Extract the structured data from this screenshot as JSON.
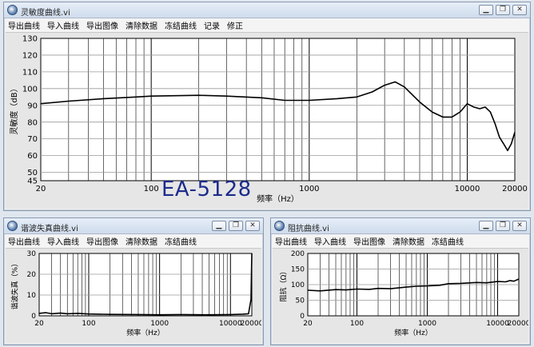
{
  "windows": [
    {
      "id": "sens",
      "title": "灵敏度曲线.vi",
      "menu": [
        "导出曲线",
        "导入曲线",
        "导出图像",
        "清除数据",
        "冻结曲线",
        "记录",
        "修正"
      ],
      "window_buttons": [
        "minimize-icon",
        "restore-icon",
        "close-icon"
      ]
    },
    {
      "id": "thd",
      "title": "谐波失真曲线.vi",
      "menu": [
        "导出曲线",
        "导入曲线",
        "导出图像",
        "清除数据",
        "冻结曲线"
      ],
      "window_buttons": [
        "minimize-icon",
        "restore-icon",
        "close-icon"
      ]
    },
    {
      "id": "imp",
      "title": "阻抗曲线.vi",
      "menu": [
        "导出曲线",
        "导入曲线",
        "导出图像",
        "清除数据",
        "冻结曲线"
      ],
      "window_buttons": [
        "minimize-icon",
        "restore-icon",
        "close-icon"
      ]
    }
  ],
  "watermark": "EA-5128",
  "colors": {
    "plot_bg": "#ffffff",
    "grid": "#000000",
    "curve": "#000000",
    "window_bg": "#f0f0f0",
    "watermark": "#1c2c8c"
  },
  "chart_data": [
    {
      "type": "line",
      "xlabel": "频率（Hz）",
      "ylabel": "灵敏度（dB）",
      "xscale": "log",
      "xlim": [
        20,
        20000
      ],
      "ylim": [
        45,
        130
      ],
      "xticks": [
        20,
        100,
        1000,
        10000,
        20000
      ],
      "yticks": [
        45,
        50,
        60,
        70,
        80,
        90,
        100,
        110,
        120,
        130
      ],
      "grid": true,
      "x": [
        20,
        30,
        50,
        80,
        100,
        200,
        300,
        500,
        700,
        1000,
        1500,
        2000,
        2500,
        3000,
        3500,
        4000,
        5000,
        6000,
        7000,
        8000,
        9000,
        10000,
        11000,
        12000,
        13000,
        14000,
        15000,
        16000,
        17000,
        18000,
        19000,
        20000
      ],
      "y": [
        91,
        92.5,
        94,
        95,
        95.5,
        96,
        95.5,
        94.5,
        93,
        93,
        94,
        95,
        98,
        102,
        104,
        101,
        92,
        86,
        83,
        83,
        86,
        91,
        89,
        88,
        89,
        86,
        79,
        71,
        67,
        63,
        67,
        74
      ]
    },
    {
      "type": "line",
      "xlabel": "频率（Hz）",
      "ylabel": "谐波失真（%）",
      "xscale": "log",
      "xlim": [
        20,
        20000
      ],
      "ylim": [
        0,
        30
      ],
      "xticks": [
        20,
        100,
        1000,
        10000,
        20000
      ],
      "yticks": [
        0,
        10,
        20,
        30
      ],
      "grid": true,
      "x": [
        20,
        25,
        30,
        40,
        50,
        70,
        100,
        200,
        500,
        1000,
        2000,
        5000,
        10000,
        15000,
        18000,
        19500,
        20000
      ],
      "y": [
        1.2,
        1.5,
        1.0,
        1.3,
        1.0,
        1.2,
        0.9,
        0.7,
        0.6,
        0.5,
        0.6,
        0.5,
        0.6,
        0.8,
        1.0,
        8,
        30
      ]
    },
    {
      "type": "line",
      "xlabel": "频率（Hz）",
      "ylabel": "阻抗（Ω）",
      "xscale": "log",
      "xlim": [
        20,
        20000
      ],
      "ylim": [
        0,
        200
      ],
      "xticks": [
        20,
        100,
        1000,
        10000,
        20000
      ],
      "yticks": [
        0,
        50,
        100,
        150,
        200
      ],
      "grid": true,
      "x": [
        20,
        30,
        50,
        70,
        100,
        150,
        200,
        300,
        500,
        700,
        1000,
        1500,
        2000,
        3000,
        5000,
        7000,
        10000,
        13000,
        15000,
        17000,
        20000
      ],
      "y": [
        82,
        80,
        84,
        83,
        86,
        85,
        88,
        87,
        92,
        95,
        96,
        98,
        103,
        104,
        107,
        106,
        110,
        109,
        113,
        111,
        118
      ]
    }
  ]
}
